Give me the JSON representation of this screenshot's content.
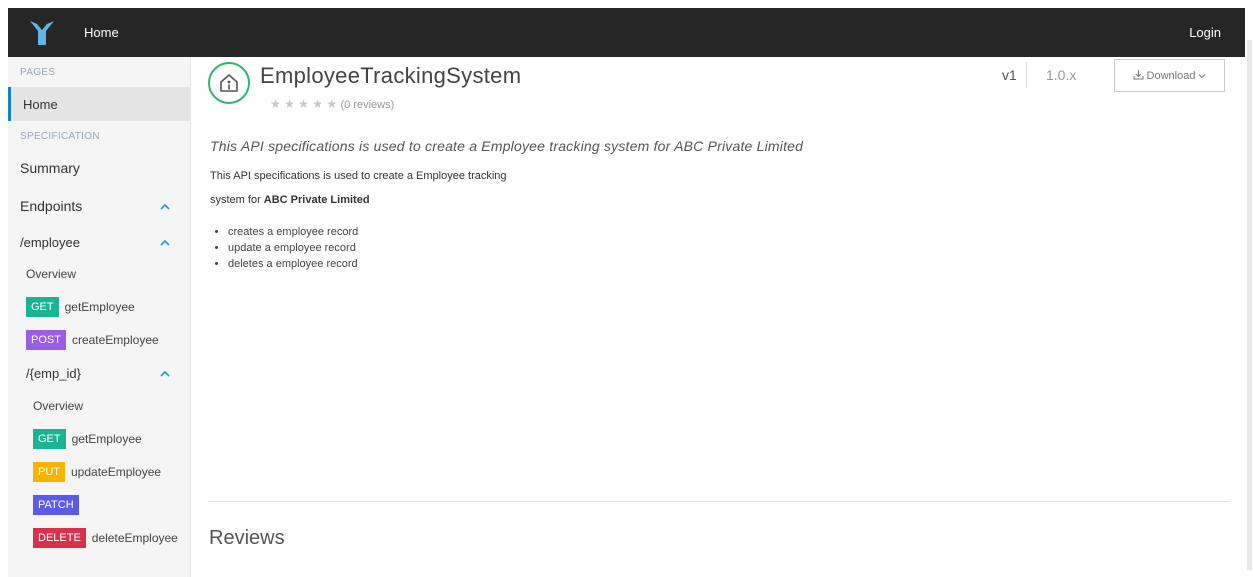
{
  "topbar": {
    "home_label": "Home",
    "login_label": "Login"
  },
  "sidebar": {
    "pages_label": "PAGES",
    "home_label": "Home",
    "specification_label": "SPECIFICATION",
    "summary_label": "Summary",
    "endpoints_label": "Endpoints",
    "chevron": "^",
    "groups": [
      {
        "path": "/employee",
        "overview": "Overview",
        "ops": [
          {
            "method": "GET",
            "name": "getEmployee"
          },
          {
            "method": "POST",
            "name": "createEmployee"
          }
        ]
      },
      {
        "path": "/{emp_id}",
        "overview": "Overview",
        "ops": [
          {
            "method": "GET",
            "name": "getEmployee"
          },
          {
            "method": "PUT",
            "name": "updateEmployee"
          },
          {
            "method": "PATCH",
            "name": ""
          },
          {
            "method": "DELETE",
            "name": "deleteEmployee"
          }
        ]
      }
    ]
  },
  "api": {
    "title": "EmployeeTrackingSystem",
    "stars": "★ ★ ★ ★ ★",
    "reviews_count": "(0 reviews)",
    "version": "v1",
    "release": "1.0.x",
    "download_label": "Download",
    "summary": "This API specifications is used to create a Employee tracking system for ABC Private Limited",
    "desc_line1": "This API specifications is used to create a Employee tracking",
    "desc_line2_prefix": "system for ",
    "desc_line2_bold": "ABC Private Limited",
    "bullets": [
      "creates a employee record",
      "update a employee record",
      "deletes a employee record"
    ],
    "reviews_heading": "Reviews"
  },
  "colors": {
    "topbar": "#262626",
    "accent": "#0f82c8",
    "get": "#1ab394",
    "post": "#9b5de5",
    "put": "#f4b400",
    "patch": "#5b5bea",
    "delete": "#d6334b",
    "api_icon": "#2db66d"
  }
}
